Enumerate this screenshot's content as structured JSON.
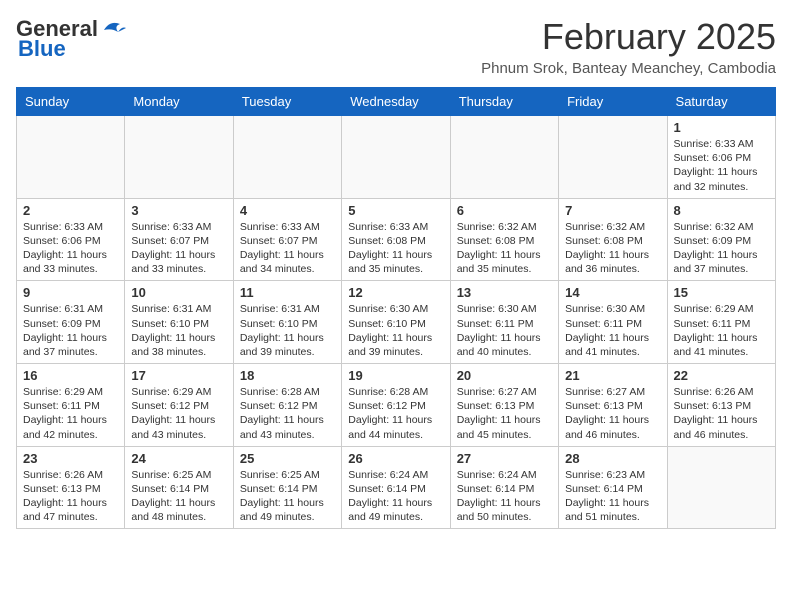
{
  "header": {
    "logo_general": "General",
    "logo_blue": "Blue",
    "month_title": "February 2025",
    "location": "Phnum Srok, Banteay Meanchey, Cambodia"
  },
  "weekdays": [
    "Sunday",
    "Monday",
    "Tuesday",
    "Wednesday",
    "Thursday",
    "Friday",
    "Saturday"
  ],
  "weeks": [
    [
      {
        "day": "",
        "info": ""
      },
      {
        "day": "",
        "info": ""
      },
      {
        "day": "",
        "info": ""
      },
      {
        "day": "",
        "info": ""
      },
      {
        "day": "",
        "info": ""
      },
      {
        "day": "",
        "info": ""
      },
      {
        "day": "1",
        "info": "Sunrise: 6:33 AM\nSunset: 6:06 PM\nDaylight: 11 hours and 32 minutes."
      }
    ],
    [
      {
        "day": "2",
        "info": "Sunrise: 6:33 AM\nSunset: 6:06 PM\nDaylight: 11 hours and 33 minutes."
      },
      {
        "day": "3",
        "info": "Sunrise: 6:33 AM\nSunset: 6:07 PM\nDaylight: 11 hours and 33 minutes."
      },
      {
        "day": "4",
        "info": "Sunrise: 6:33 AM\nSunset: 6:07 PM\nDaylight: 11 hours and 34 minutes."
      },
      {
        "day": "5",
        "info": "Sunrise: 6:33 AM\nSunset: 6:08 PM\nDaylight: 11 hours and 35 minutes."
      },
      {
        "day": "6",
        "info": "Sunrise: 6:32 AM\nSunset: 6:08 PM\nDaylight: 11 hours and 35 minutes."
      },
      {
        "day": "7",
        "info": "Sunrise: 6:32 AM\nSunset: 6:08 PM\nDaylight: 11 hours and 36 minutes."
      },
      {
        "day": "8",
        "info": "Sunrise: 6:32 AM\nSunset: 6:09 PM\nDaylight: 11 hours and 37 minutes."
      }
    ],
    [
      {
        "day": "9",
        "info": "Sunrise: 6:31 AM\nSunset: 6:09 PM\nDaylight: 11 hours and 37 minutes."
      },
      {
        "day": "10",
        "info": "Sunrise: 6:31 AM\nSunset: 6:10 PM\nDaylight: 11 hours and 38 minutes."
      },
      {
        "day": "11",
        "info": "Sunrise: 6:31 AM\nSunset: 6:10 PM\nDaylight: 11 hours and 39 minutes."
      },
      {
        "day": "12",
        "info": "Sunrise: 6:30 AM\nSunset: 6:10 PM\nDaylight: 11 hours and 39 minutes."
      },
      {
        "day": "13",
        "info": "Sunrise: 6:30 AM\nSunset: 6:11 PM\nDaylight: 11 hours and 40 minutes."
      },
      {
        "day": "14",
        "info": "Sunrise: 6:30 AM\nSunset: 6:11 PM\nDaylight: 11 hours and 41 minutes."
      },
      {
        "day": "15",
        "info": "Sunrise: 6:29 AM\nSunset: 6:11 PM\nDaylight: 11 hours and 41 minutes."
      }
    ],
    [
      {
        "day": "16",
        "info": "Sunrise: 6:29 AM\nSunset: 6:11 PM\nDaylight: 11 hours and 42 minutes."
      },
      {
        "day": "17",
        "info": "Sunrise: 6:29 AM\nSunset: 6:12 PM\nDaylight: 11 hours and 43 minutes."
      },
      {
        "day": "18",
        "info": "Sunrise: 6:28 AM\nSunset: 6:12 PM\nDaylight: 11 hours and 43 minutes."
      },
      {
        "day": "19",
        "info": "Sunrise: 6:28 AM\nSunset: 6:12 PM\nDaylight: 11 hours and 44 minutes."
      },
      {
        "day": "20",
        "info": "Sunrise: 6:27 AM\nSunset: 6:13 PM\nDaylight: 11 hours and 45 minutes."
      },
      {
        "day": "21",
        "info": "Sunrise: 6:27 AM\nSunset: 6:13 PM\nDaylight: 11 hours and 46 minutes."
      },
      {
        "day": "22",
        "info": "Sunrise: 6:26 AM\nSunset: 6:13 PM\nDaylight: 11 hours and 46 minutes."
      }
    ],
    [
      {
        "day": "23",
        "info": "Sunrise: 6:26 AM\nSunset: 6:13 PM\nDaylight: 11 hours and 47 minutes."
      },
      {
        "day": "24",
        "info": "Sunrise: 6:25 AM\nSunset: 6:14 PM\nDaylight: 11 hours and 48 minutes."
      },
      {
        "day": "25",
        "info": "Sunrise: 6:25 AM\nSunset: 6:14 PM\nDaylight: 11 hours and 49 minutes."
      },
      {
        "day": "26",
        "info": "Sunrise: 6:24 AM\nSunset: 6:14 PM\nDaylight: 11 hours and 49 minutes."
      },
      {
        "day": "27",
        "info": "Sunrise: 6:24 AM\nSunset: 6:14 PM\nDaylight: 11 hours and 50 minutes."
      },
      {
        "day": "28",
        "info": "Sunrise: 6:23 AM\nSunset: 6:14 PM\nDaylight: 11 hours and 51 minutes."
      },
      {
        "day": "",
        "info": ""
      }
    ]
  ]
}
